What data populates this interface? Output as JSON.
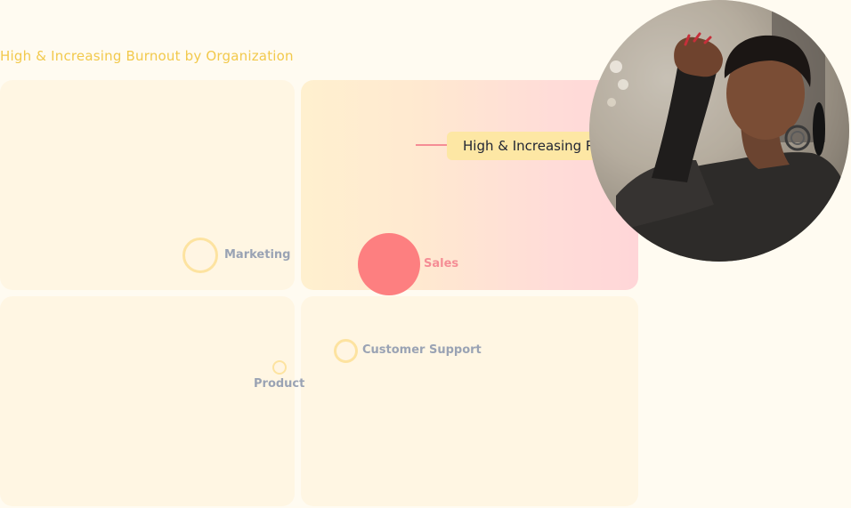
{
  "chart": {
    "title": "High & Increasing Burnout by Organization",
    "callout": "High & Increasing Red Zone Ratio",
    "colors": {
      "highlight": "#fd7f80",
      "ring": "#fde3a0",
      "callout_bg": "#fde7a4",
      "title": "#f2c94c"
    }
  },
  "organizations": [
    {
      "name": "Marketing",
      "highlighted": false
    },
    {
      "name": "Sales",
      "highlighted": true
    },
    {
      "name": "Customer Support",
      "highlighted": false
    },
    {
      "name": "Product",
      "highlighted": false
    }
  ],
  "photo": {
    "subject": "person with hands clasped on forehead"
  }
}
